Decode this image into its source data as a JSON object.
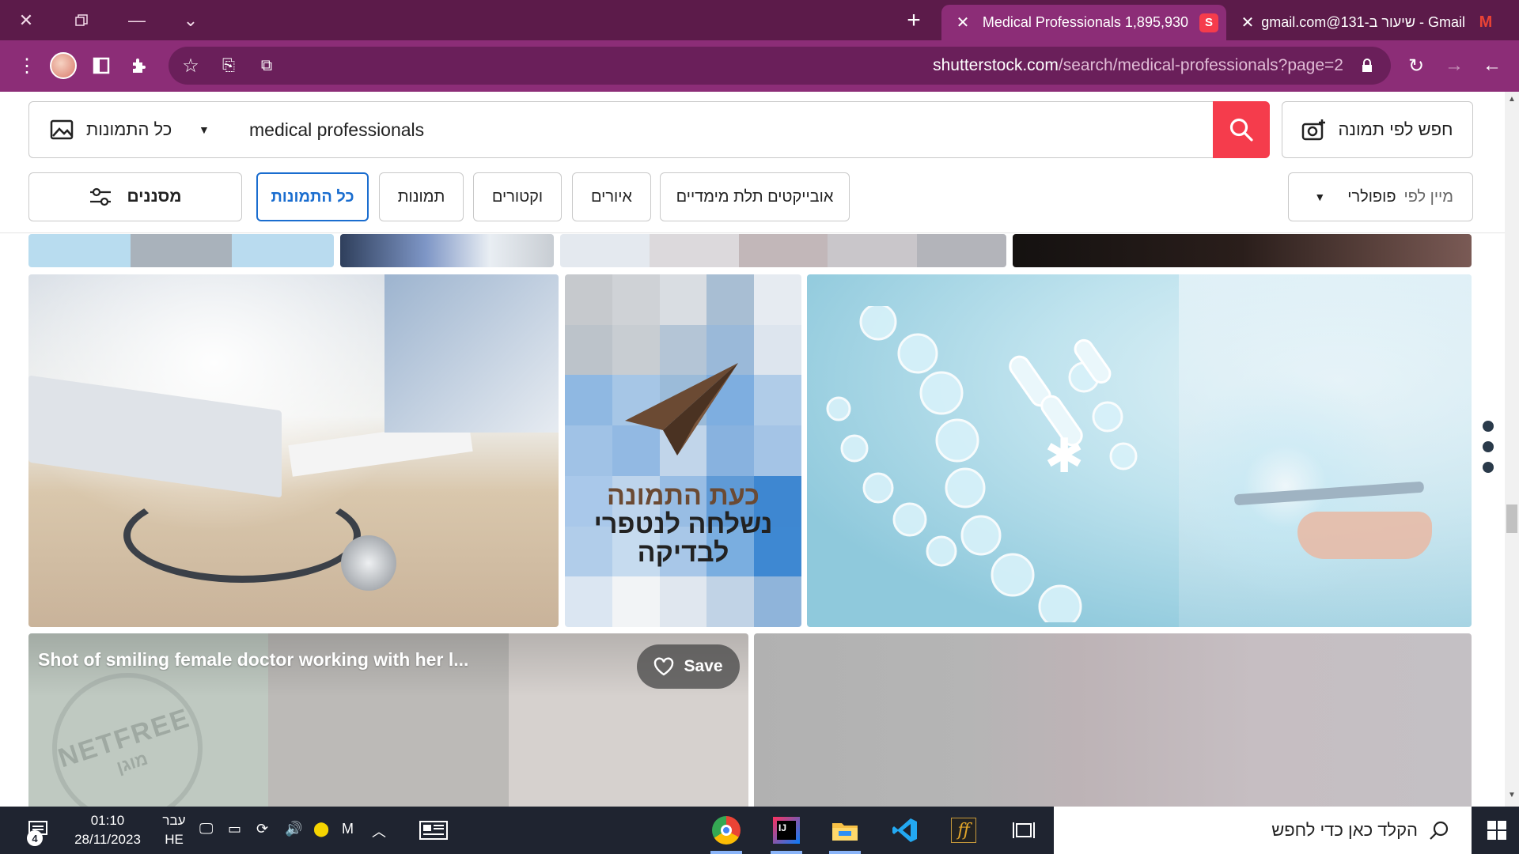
{
  "browser": {
    "tabs": [
      {
        "title": "1,895,930 Medical Professionals",
        "active": true
      },
      {
        "title": "Gmail - שיעור ב-131@gmail.com",
        "active": false
      }
    ],
    "url_host": "shutterstock.com",
    "url_path": "/search/medical-professionals?page=2",
    "accent": "#8c2d77",
    "titlebar_color": "#5c1b4a"
  },
  "search": {
    "category": "כל התמונות",
    "query": "medical professionals",
    "image_search_label": "חפש לפי תמונה",
    "button_color": "#f53c4c"
  },
  "filters": {
    "filters_label": "מסננים",
    "types": [
      "כל התמונות",
      "תמונות",
      "וקטורים",
      "איורים",
      "אובייקטים תלת מימדיים"
    ],
    "selected_type": "כל התמונות",
    "sort_prefix": "מיין לפי",
    "sort_value": "פופולרי"
  },
  "results": {
    "blocked_notice": [
      "כעת התמונה",
      "נשלחה לנטפרי",
      "לבדיקה"
    ],
    "hover_title": "Shot of smiling female doctor working with her l...",
    "save_label": "Save",
    "watermark": "NETFREE",
    "watermark_sub": "מוגן"
  },
  "taskbar": {
    "search_placeholder": "הקלד כאן כדי לחפש",
    "time": "01:10",
    "date": "28/11/2023",
    "lang_top": "עבר",
    "lang_bottom": "HE",
    "notifications": "4"
  }
}
